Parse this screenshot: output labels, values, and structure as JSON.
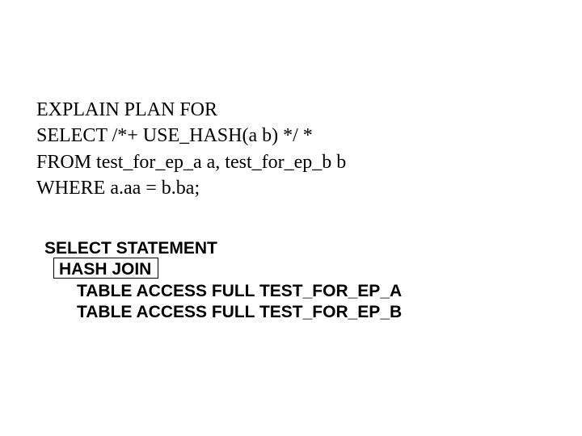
{
  "sql": {
    "line1": "EXPLAIN PLAN FOR",
    "line2": "SELECT /*+ USE_HASH(a b) */ *",
    "line3": "FROM test_for_ep_a a, test_for_ep_b b",
    "line4": "WHERE a.aa = b.ba;"
  },
  "plan": {
    "line1": "SELECT STATEMENT",
    "line2": "HASH JOIN",
    "line3": "TABLE ACCESS FULL TEST_FOR_EP_A",
    "line4": "TABLE ACCESS FULL TEST_FOR_EP_B"
  }
}
